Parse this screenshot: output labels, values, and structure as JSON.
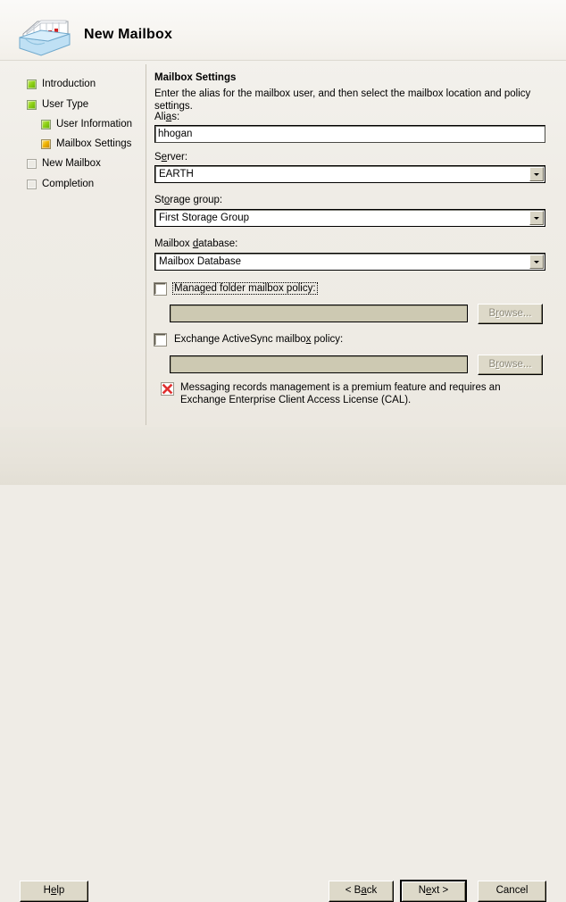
{
  "header": {
    "title": "New Mailbox",
    "icon": "mailbox-tray-icon"
  },
  "sidebar": {
    "items": [
      {
        "label": "Introduction",
        "status": "done",
        "indent": 0
      },
      {
        "label": "User Type",
        "status": "done",
        "indent": 0
      },
      {
        "label": "User Information",
        "status": "done",
        "indent": 1
      },
      {
        "label": "Mailbox Settings",
        "status": "current",
        "indent": 1
      },
      {
        "label": "New Mailbox",
        "status": "pending",
        "indent": 0
      },
      {
        "label": "Completion",
        "status": "pending",
        "indent": 0
      }
    ]
  },
  "main": {
    "title": "Mailbox Settings",
    "description": "Enter the alias for the mailbox user, and then select the mailbox location and policy settings.",
    "alias": {
      "label_pre": "Ali",
      "label_acc": "a",
      "label_post": "s:",
      "value": "hhogan",
      "placeholder": ""
    },
    "server": {
      "label_pre": "S",
      "label_acc": "e",
      "label_post": "rver:",
      "value": "EARTH"
    },
    "storage_group": {
      "label_pre": "St",
      "label_acc": "o",
      "label_post": "rage group:",
      "value": "First Storage Group"
    },
    "mailbox_database": {
      "label_pre": "Mailbox ",
      "label_acc": "d",
      "label_post": "atabase:",
      "value": "Mailbox Database"
    },
    "managed_folder": {
      "label": "Managed folder mailbox policy:",
      "checked": false,
      "value": "",
      "browse_label_pre": "B",
      "browse_label_acc": "r",
      "browse_label_post": "owse..."
    },
    "activesync": {
      "label_pre": "Exchange ActiveSync mailbo",
      "label_acc": "x",
      "label_post": " policy:",
      "checked": false,
      "value": "",
      "browse_label_pre": "B",
      "browse_label_acc": "r",
      "browse_label_post": "owse..."
    },
    "note": {
      "icon": "broken-image-icon",
      "text": "Messaging records management is a premium feature and requires an Exchange Enterprise Client Access License (CAL)."
    }
  },
  "footer": {
    "help": {
      "pre": "H",
      "acc": "e",
      "post": "lp"
    },
    "back": {
      "pre": "< B",
      "acc": "a",
      "post": "ck"
    },
    "next": {
      "pre": "N",
      "acc": "e",
      "post": "xt >"
    },
    "cancel": {
      "pre": "Cancel",
      "acc": "",
      "post": ""
    }
  },
  "colors": {
    "background": "#efece6",
    "done": "#8fd116",
    "current": "#f0b400",
    "pending": "#eceae4",
    "disabled_field": "#cdc9b2",
    "button_face": "#ddd9c9",
    "accent_red": "#e03030"
  }
}
